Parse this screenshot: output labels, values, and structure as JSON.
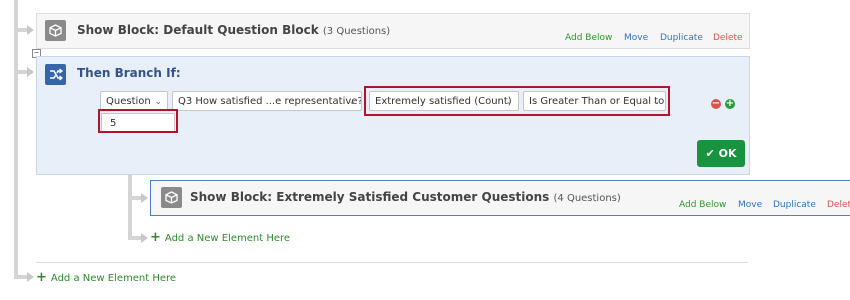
{
  "block1": {
    "title": "Show Block: Default Question Block",
    "count": "(3 Questions)",
    "actions": {
      "add_below": "Add Below",
      "move": "Move",
      "duplicate": "Duplicate",
      "delete": "Delete"
    }
  },
  "collapse_glyph": "⊟",
  "branch": {
    "title": "Then Branch If:",
    "condition": {
      "type": "Question",
      "question": "Q3 How satisfied ...e representative?",
      "choice": "Extremely satisfied (Count)",
      "operator": "Is Greater Than or Equal to",
      "value": "5"
    },
    "ok_label": "OK"
  },
  "block2": {
    "title": "Show Block: Extremely Satisfied Customer Questions",
    "count": "(4 Questions)",
    "actions": {
      "add_below": "Add Below",
      "move": "Move",
      "duplicate": "Duplicate",
      "delete": "Delete"
    }
  },
  "add_element_inner": "Add a New Element Here",
  "add_element_outer": "Add a New Element Here",
  "colors": {
    "branch_bg": "#e8eff8",
    "highlight": "#b3132b",
    "ok_green": "#17943d",
    "action_blue": "#2f74c6"
  }
}
